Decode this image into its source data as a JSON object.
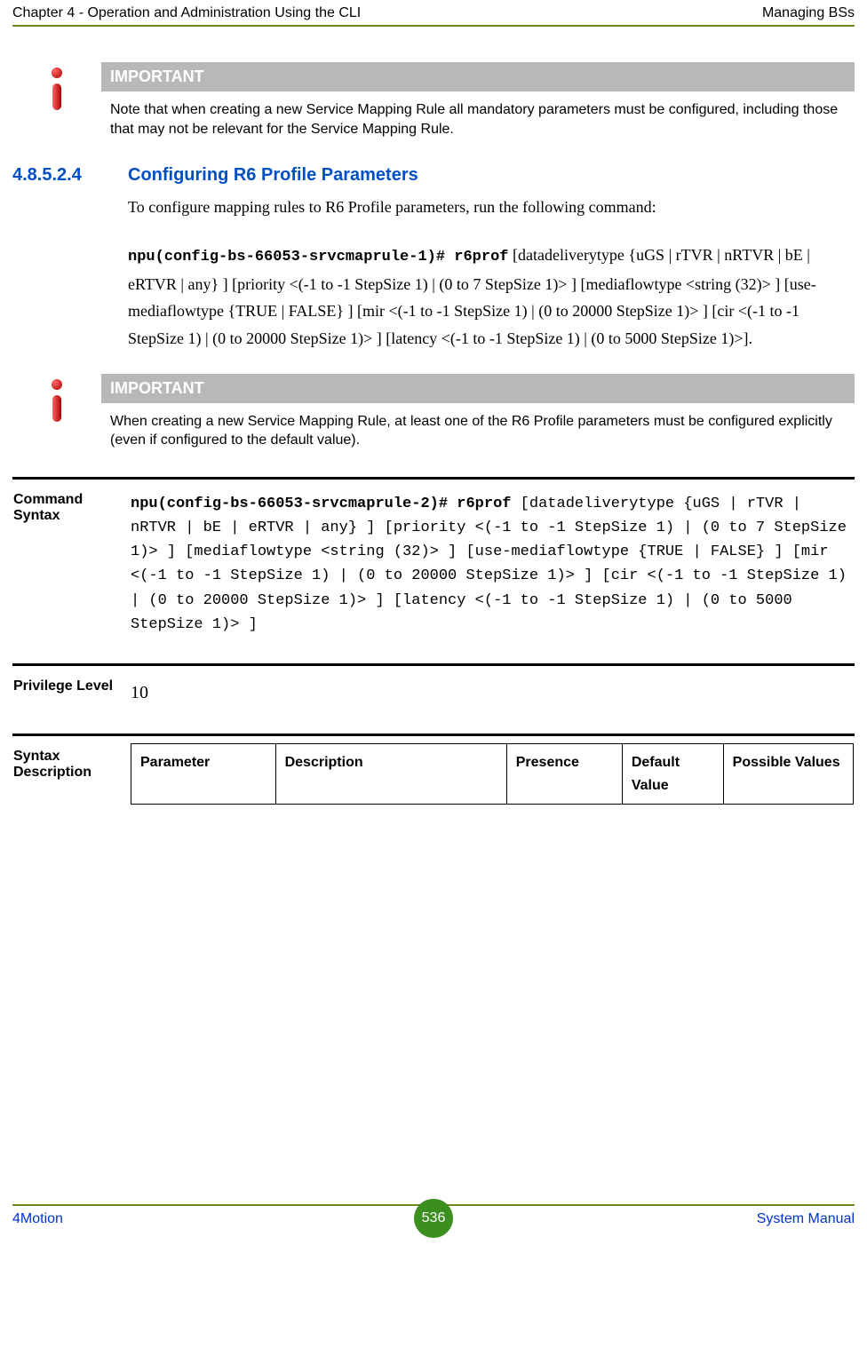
{
  "header": {
    "left": "Chapter 4 - Operation and Administration Using the CLI",
    "right": "Managing BSs"
  },
  "important1": {
    "label": "IMPORTANT",
    "text": "Note that when creating a new Service Mapping Rule all mandatory parameters must be configured, including those that may not be relevant for the Service Mapping Rule."
  },
  "section": {
    "num": "4.8.5.2.4",
    "title": "Configuring R6 Profile Parameters",
    "intro": "To configure mapping rules to R6 Profile parameters, run the following command:",
    "cmd_bold": "npu(config-bs-66053-srvcmaprule-1)# r6prof",
    "cmd_rest": " [datadeliverytype {uGS | rTVR | nRTVR | bE | eRTVR | any} ] [priority <(-1 to -1 StepSize 1) | (0 to 7 StepSize 1)> ] [mediaflowtype <string (32)> ] [use-mediaflowtype {TRUE | FALSE} ] [mir <(-1 to -1 StepSize 1) | (0 to 20000 StepSize 1)> ] [cir <(-1 to -1 StepSize 1) | (0 to 20000 StepSize 1)> ] [latency <(-1 to -1 StepSize 1) | (0 to 5000 StepSize 1)>]."
  },
  "important2": {
    "label": "IMPORTANT",
    "text": "When creating a new Service Mapping Rule, at least one of the R6 Profile parameters must be configured explicitly (even if configured to the default value)."
  },
  "defs": {
    "command_syntax_label": "Command Syntax",
    "command_syntax_bold": "npu(config-bs-66053-srvcmaprule-2)# r6prof",
    "command_syntax_rest": " [datadeliverytype {uGS | rTVR | nRTVR | bE | eRTVR | any} ] [priority <(-1 to -1 StepSize 1) | (0 to 7 StepSize 1)> ] [mediaflowtype <string (32)> ] [use-mediaflowtype {TRUE | FALSE} ] [mir <(-1 to -1 StepSize 1) | (0 to 20000 StepSize 1)> ] [cir <(-1 to -1 StepSize 1) | (0 to 20000 StepSize 1)> ] [latency <(-1 to -1 StepSize 1) | (0 to 5000 StepSize 1)> ]",
    "privilege_label": "Privilege Level",
    "privilege_value": "10",
    "syntax_desc_label": "Syntax Description",
    "syntax_headers": {
      "parameter": "Parameter",
      "description": "Description",
      "presence": "Presence",
      "default_value": "Default Value",
      "possible_values": "Possible Values"
    }
  },
  "footer": {
    "left": "4Motion",
    "page": "536",
    "right": "System Manual"
  }
}
